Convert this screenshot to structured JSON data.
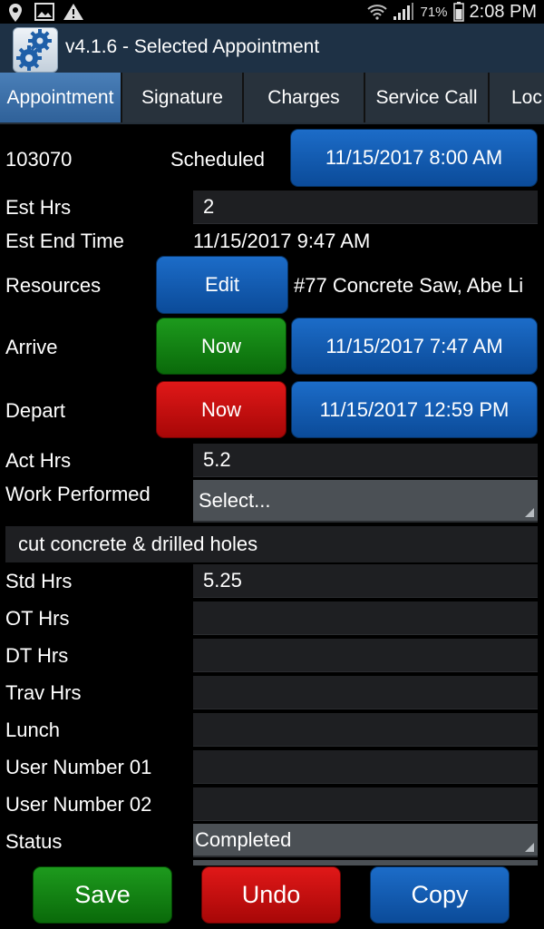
{
  "status_bar": {
    "icons": [
      "location-icon",
      "image-icon",
      "warning-icon",
      "wifi-icon",
      "signal-icon",
      "battery-icon"
    ],
    "battery": "71%",
    "time": "2:08 PM"
  },
  "title_bar": {
    "title": "v4.1.6 - Selected Appointment",
    "icon": "gears-icon"
  },
  "tabs": [
    {
      "label": "Appointment",
      "active": true
    },
    {
      "label": "Signature"
    },
    {
      "label": "Charges"
    },
    {
      "label": "Service Call"
    },
    {
      "label": "Loc"
    }
  ],
  "appointment": {
    "number": "103070",
    "status": "Scheduled",
    "scheduled_datetime": "11/15/2017 8:00 AM"
  },
  "est_hrs": {
    "label": "Est Hrs",
    "value": "2"
  },
  "est_end": {
    "label": "Est End Time",
    "value": "11/15/2017 9:47 AM"
  },
  "resources": {
    "label": "Resources",
    "button": "Edit",
    "value": "#77 Concrete Saw, Abe Li"
  },
  "arrive": {
    "label": "Arrive",
    "button": "Now",
    "datetime": "11/15/2017 7:47 AM"
  },
  "depart": {
    "label": "Depart",
    "button": "Now",
    "datetime": "11/15/2017 12:59 PM"
  },
  "act_hrs": {
    "label": "Act Hrs",
    "value": "5.2"
  },
  "work_performed": {
    "label": "Work Performed",
    "selected": "Select...",
    "notes": "cut concrete & drilled holes"
  },
  "std_hrs": {
    "label": "Std Hrs",
    "value": "5.25"
  },
  "ot_hrs": {
    "label": "OT Hrs",
    "value": ""
  },
  "dt_hrs": {
    "label": "DT Hrs",
    "value": ""
  },
  "trav_hrs": {
    "label": "Trav Hrs",
    "value": ""
  },
  "lunch": {
    "label": "Lunch",
    "value": ""
  },
  "user_number_01": {
    "label": "User Number 01",
    "value": ""
  },
  "user_number_02": {
    "label": "User Number 02",
    "value": ""
  },
  "status": {
    "label": "Status",
    "selected": "Completed"
  },
  "actions": {
    "save": "Save",
    "undo": "Undo",
    "copy": "Copy"
  },
  "colors": {
    "blue": "#0b4b99",
    "green": "#0a6a0a",
    "red": "#a70707",
    "tab_active": "#3a6fa8"
  }
}
